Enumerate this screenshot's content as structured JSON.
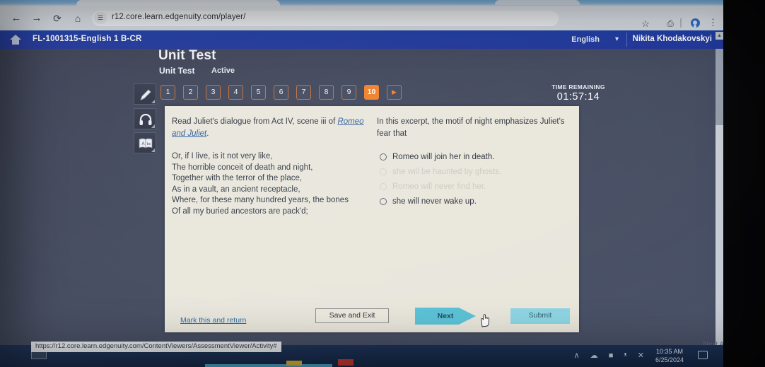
{
  "browser": {
    "url": "r12.core.learn.edgenuity.com/player/",
    "back_icon": "back-arrow-icon",
    "forward_icon": "forward-arrow-icon",
    "reload_icon": "reload-icon",
    "home_icon": "home-icon",
    "site_settings_icon": "site-settings-icon",
    "star_icon": "bookmark-star-icon",
    "split_icon": "split-screen-icon",
    "menu_icon": "kebab-menu-icon"
  },
  "app_header": {
    "course_code": "FL-1001315-English 1 B-CR",
    "language": "English",
    "language_caret": "⌄",
    "user_name": "Nikita Khodakovskyi",
    "home_glyph": "⌂"
  },
  "activity": {
    "title": "Unit Test",
    "subtitle": "Unit Test",
    "status": "Active",
    "add_button": "+",
    "time_label": "TIME REMAINING",
    "time_value": "01:57:14",
    "question_numbers": [
      "1",
      "2",
      "3",
      "4",
      "5",
      "6",
      "7",
      "8",
      "9",
      "10"
    ],
    "active_question": "10",
    "next_arrow": "▶"
  },
  "tools": [
    {
      "name": "highlighter-tool",
      "label": "Highlighter"
    },
    {
      "name": "audio-tool",
      "label": "Text to speech"
    },
    {
      "name": "dictionary-tool",
      "label": "Dictionary"
    }
  ],
  "passage": {
    "lead_before": "Read Juliet's dialogue from Act IV, scene iii of ",
    "lead_title": "Romeo and Juliet",
    "lead_after": ".",
    "lines": [
      "Or, if I live, is it not very like,",
      "The horrible conceit of death and night,",
      "Together with the terror of the place,",
      "As in a vault, an ancient receptacle,",
      "Where, for these many hundred years, the bones",
      "Of all my buried ancestors are pack'd;"
    ]
  },
  "question": {
    "stem": "In this excerpt, the motif of night emphasizes Juliet's fear that",
    "options": [
      {
        "text": "Romeo will join her in death.",
        "faded": false,
        "selected": false
      },
      {
        "text": "she will be haunted by ghosts.",
        "faded": true,
        "selected": false
      },
      {
        "text": "Romeo will never find her.",
        "faded": true,
        "selected": false
      },
      {
        "text": "she will never wake up.",
        "faded": false,
        "selected": false
      }
    ]
  },
  "panel_actions": {
    "mark_link": "Mark this and return",
    "save_and_exit": "Save and Exit",
    "next": "Next",
    "submit": "Submit"
  },
  "footer": {
    "next_activity": "Next Activity",
    "next_activity_icon": "play-arrow-icon"
  },
  "taskbar": {
    "status_url": "https://r12.core.learn.edgenuity.com/ContentViewers/AssessmentViewer/Activity#",
    "tray_icons": "∧ ☁ ■ ᵜ ✕",
    "time": "10:35 AM",
    "date": "6/25/2024",
    "notification_icon": "notification-icon"
  },
  "colors": {
    "accent_orange": "#ef7f2a",
    "header_blue": "#23379b",
    "teal_button": "#5cc3d8",
    "panel_bg": "#e9e7dc"
  }
}
